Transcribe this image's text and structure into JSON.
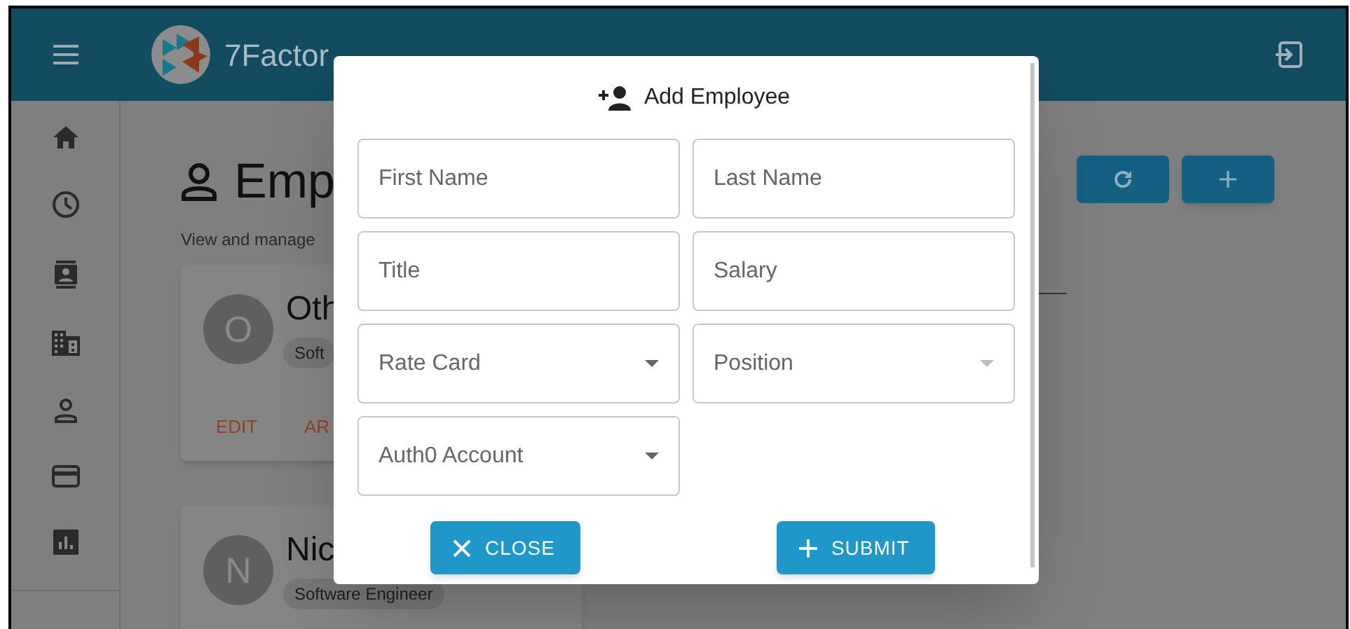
{
  "app_bar": {
    "title": "7Factor"
  },
  "page": {
    "heading": "Emp",
    "subtitle": "View and manage"
  },
  "employees": [
    {
      "initial": "O",
      "name": "Oth",
      "chip": "Soft",
      "actions": [
        "EDIT",
        "AR"
      ]
    },
    {
      "initial": "N",
      "name": "Nic",
      "chip": "Software Engineer"
    }
  ],
  "dialog": {
    "title": "Add Employee",
    "fields": [
      {
        "kind": "text",
        "placeholder": "First Name"
      },
      {
        "kind": "text",
        "placeholder": "Last Name"
      },
      {
        "kind": "text",
        "placeholder": "Title"
      },
      {
        "kind": "text",
        "placeholder": "Salary"
      },
      {
        "kind": "select",
        "label": "Rate Card",
        "disabled": false
      },
      {
        "kind": "select",
        "label": "Position",
        "disabled": true
      },
      {
        "kind": "select",
        "label": "Auth0 Account",
        "disabled": false
      }
    ],
    "buttons": [
      {
        "kind": "close",
        "label": "CLOSE"
      },
      {
        "kind": "submit",
        "label": "SUBMIT"
      }
    ]
  }
}
